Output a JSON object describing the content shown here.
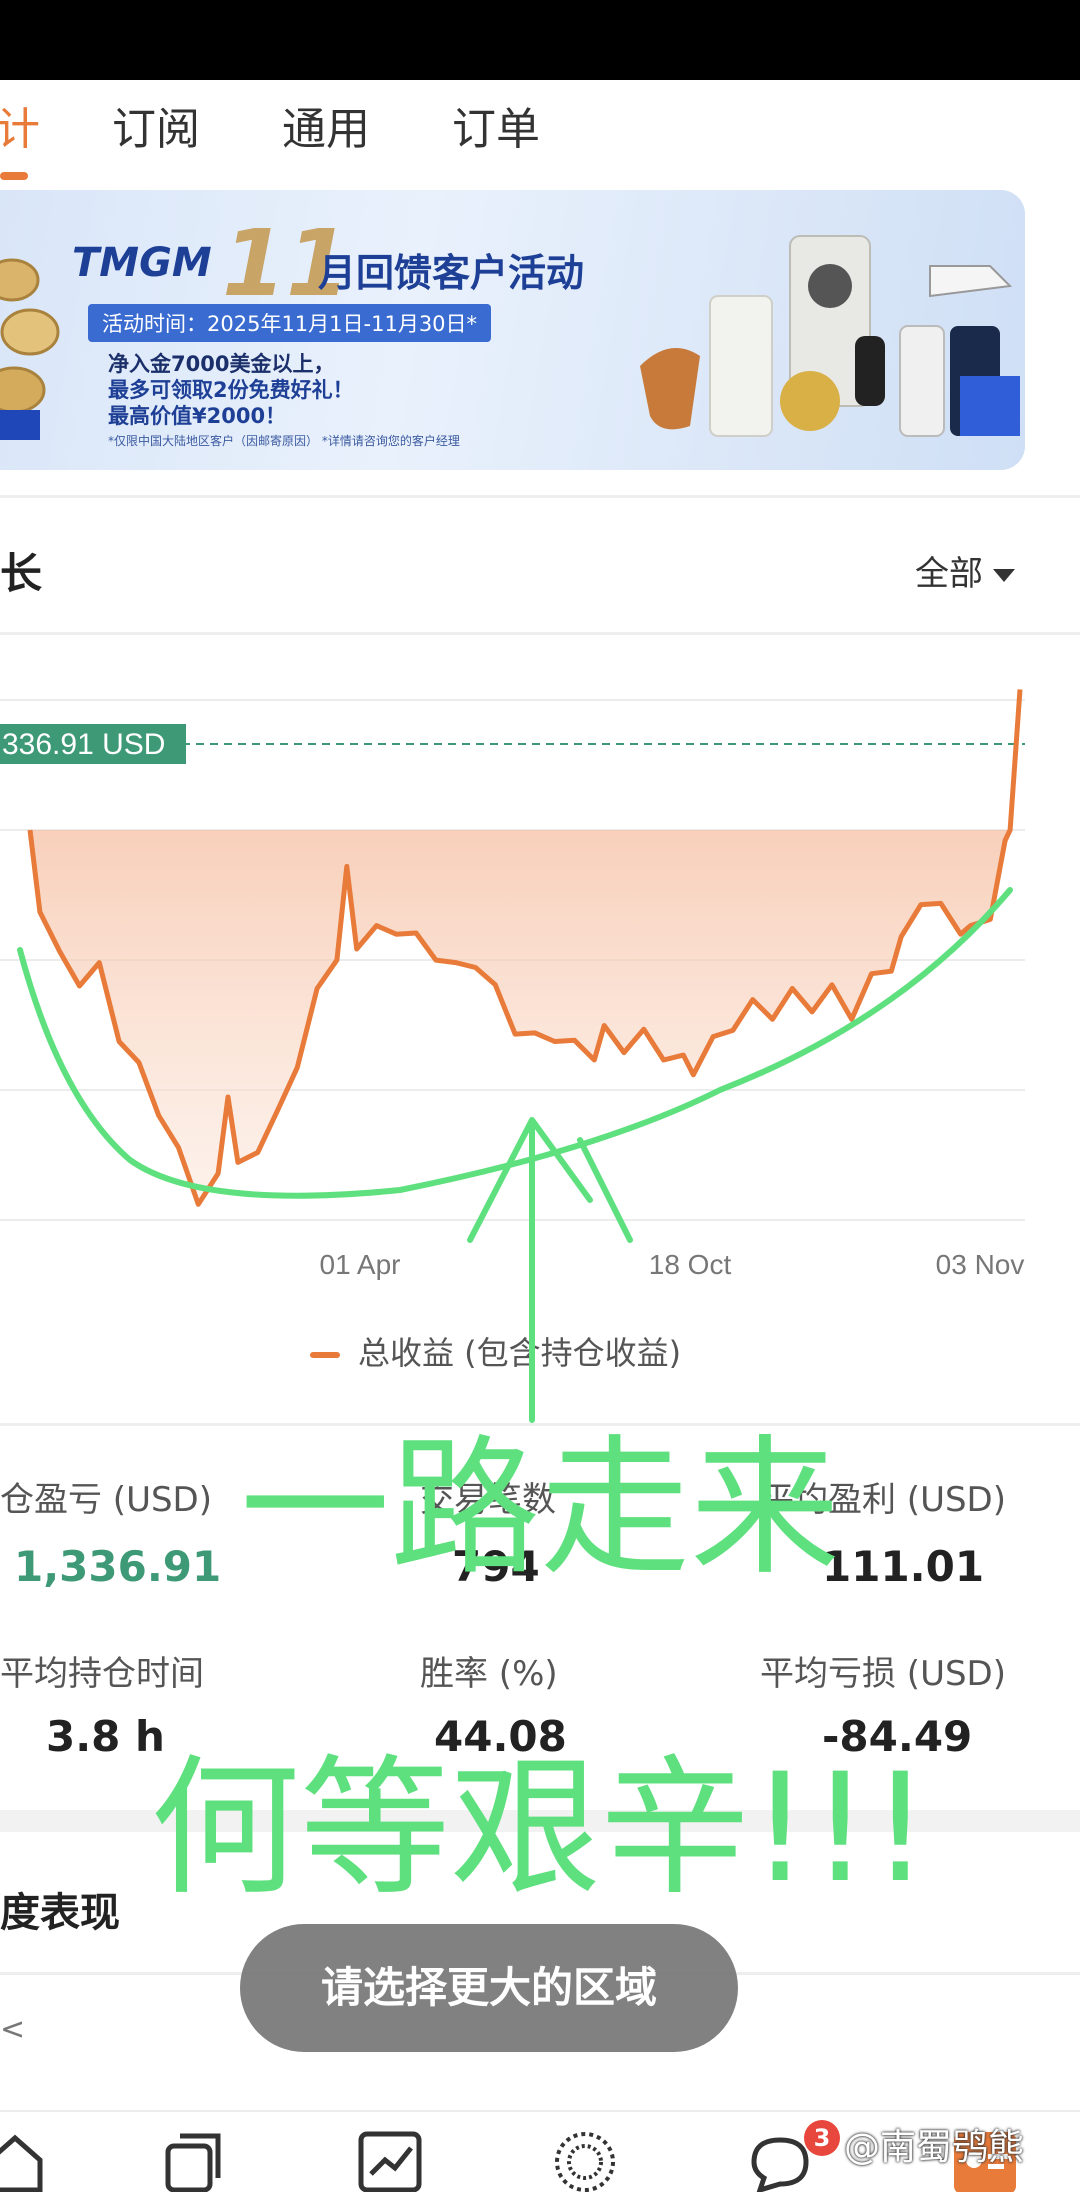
{
  "tabs": [
    {
      "label": "计"
    },
    {
      "label": "订阅"
    },
    {
      "label": "通用"
    },
    {
      "label": "订单"
    }
  ],
  "banner": {
    "brand": "TMGM",
    "number": "11",
    "title": "月回馈客户活动",
    "date": "活动时间：2025年11月1日-11月30日*",
    "line1": "净入金7000美金以上，",
    "line2": "最多可领取2份免费好礼！",
    "line3": "最高价值¥2000！",
    "fine": "*仅限中国大陆地区客户（因邮寄原因）   *详情请咨询您的客户经理"
  },
  "growth": {
    "title": "长",
    "filter": "全部"
  },
  "chart_data": {
    "type": "area",
    "series": [
      {
        "name": "总收益 (包含持仓收益)",
        "color": "#e87a3a"
      }
    ],
    "x_ticks": [
      "01 Apr",
      "18 Oct",
      "03 Nov"
    ],
    "current_value_label": "336.91 USD",
    "points": [
      [
        0.0,
        0.0
      ],
      [
        0.01,
        0.2
      ],
      [
        0.03,
        0.35
      ],
      [
        0.05,
        0.4
      ],
      [
        0.07,
        0.38
      ],
      [
        0.09,
        0.55
      ],
      [
        0.11,
        0.65
      ],
      [
        0.13,
        0.75
      ],
      [
        0.15,
        0.88
      ],
      [
        0.17,
        0.99
      ],
      [
        0.19,
        0.95
      ],
      [
        0.2,
        0.7
      ],
      [
        0.21,
        0.92
      ],
      [
        0.23,
        0.85
      ],
      [
        0.25,
        0.78
      ],
      [
        0.27,
        0.62
      ],
      [
        0.29,
        0.45
      ],
      [
        0.31,
        0.33
      ],
      [
        0.32,
        0.12
      ],
      [
        0.33,
        0.3
      ],
      [
        0.35,
        0.28
      ],
      [
        0.37,
        0.26
      ],
      [
        0.39,
        0.3
      ],
      [
        0.41,
        0.33
      ],
      [
        0.43,
        0.38
      ],
      [
        0.45,
        0.35
      ],
      [
        0.47,
        0.44
      ],
      [
        0.49,
        0.53
      ],
      [
        0.51,
        0.57
      ],
      [
        0.53,
        0.55
      ],
      [
        0.55,
        0.59
      ],
      [
        0.57,
        0.6
      ],
      [
        0.58,
        0.55
      ],
      [
        0.6,
        0.58
      ],
      [
        0.62,
        0.56
      ],
      [
        0.64,
        0.6
      ],
      [
        0.66,
        0.63
      ],
      [
        0.67,
        0.64
      ],
      [
        0.69,
        0.58
      ],
      [
        0.71,
        0.52
      ],
      [
        0.73,
        0.48
      ],
      [
        0.75,
        0.49
      ],
      [
        0.77,
        0.45
      ],
      [
        0.79,
        0.47
      ],
      [
        0.81,
        0.44
      ],
      [
        0.83,
        0.49
      ],
      [
        0.85,
        0.41
      ],
      [
        0.87,
        0.36
      ],
      [
        0.88,
        0.31
      ],
      [
        0.9,
        0.18
      ],
      [
        0.92,
        0.22
      ],
      [
        0.94,
        0.26
      ],
      [
        0.95,
        0.28
      ],
      [
        0.97,
        0.22
      ],
      [
        0.985,
        0.05
      ],
      [
        0.99,
        0.0
      ],
      [
        1.0,
        -0.38
      ]
    ]
  },
  "stats": {
    "pnl_label": "仓盈亏 (USD)",
    "pnl_value": "1,336.91",
    "trades_label": "交易笔数",
    "trades_value": "794",
    "avg_profit_label": "平均盈利 (USD)",
    "avg_profit_value": "111.01",
    "avg_hold_label": "平均持仓时间",
    "avg_hold_value": "3.8 h",
    "winrate_label": "胜率 (%)",
    "winrate_value": "44.08",
    "avg_loss_label": "平均亏损 (USD)",
    "avg_loss_value": "-84.49"
  },
  "performance": {
    "title": "度表现",
    "chevron": "<"
  },
  "toast": "请选择更大的区域",
  "bottom_nav": {
    "items": [
      "home-icon",
      "copy-trade-icon",
      "trend-chart-icon",
      "globe-icon",
      "chat-icon",
      "profile-card-icon"
    ],
    "chat_badge": "3",
    "watermark": "@南蜀鸮熊"
  },
  "annotation": {
    "line1": "一路走来",
    "line2": "何等艰辛!!!"
  },
  "colors": {
    "accent": "#e87a3a",
    "green": "#3e9a76",
    "ink": "#5fe07f"
  }
}
